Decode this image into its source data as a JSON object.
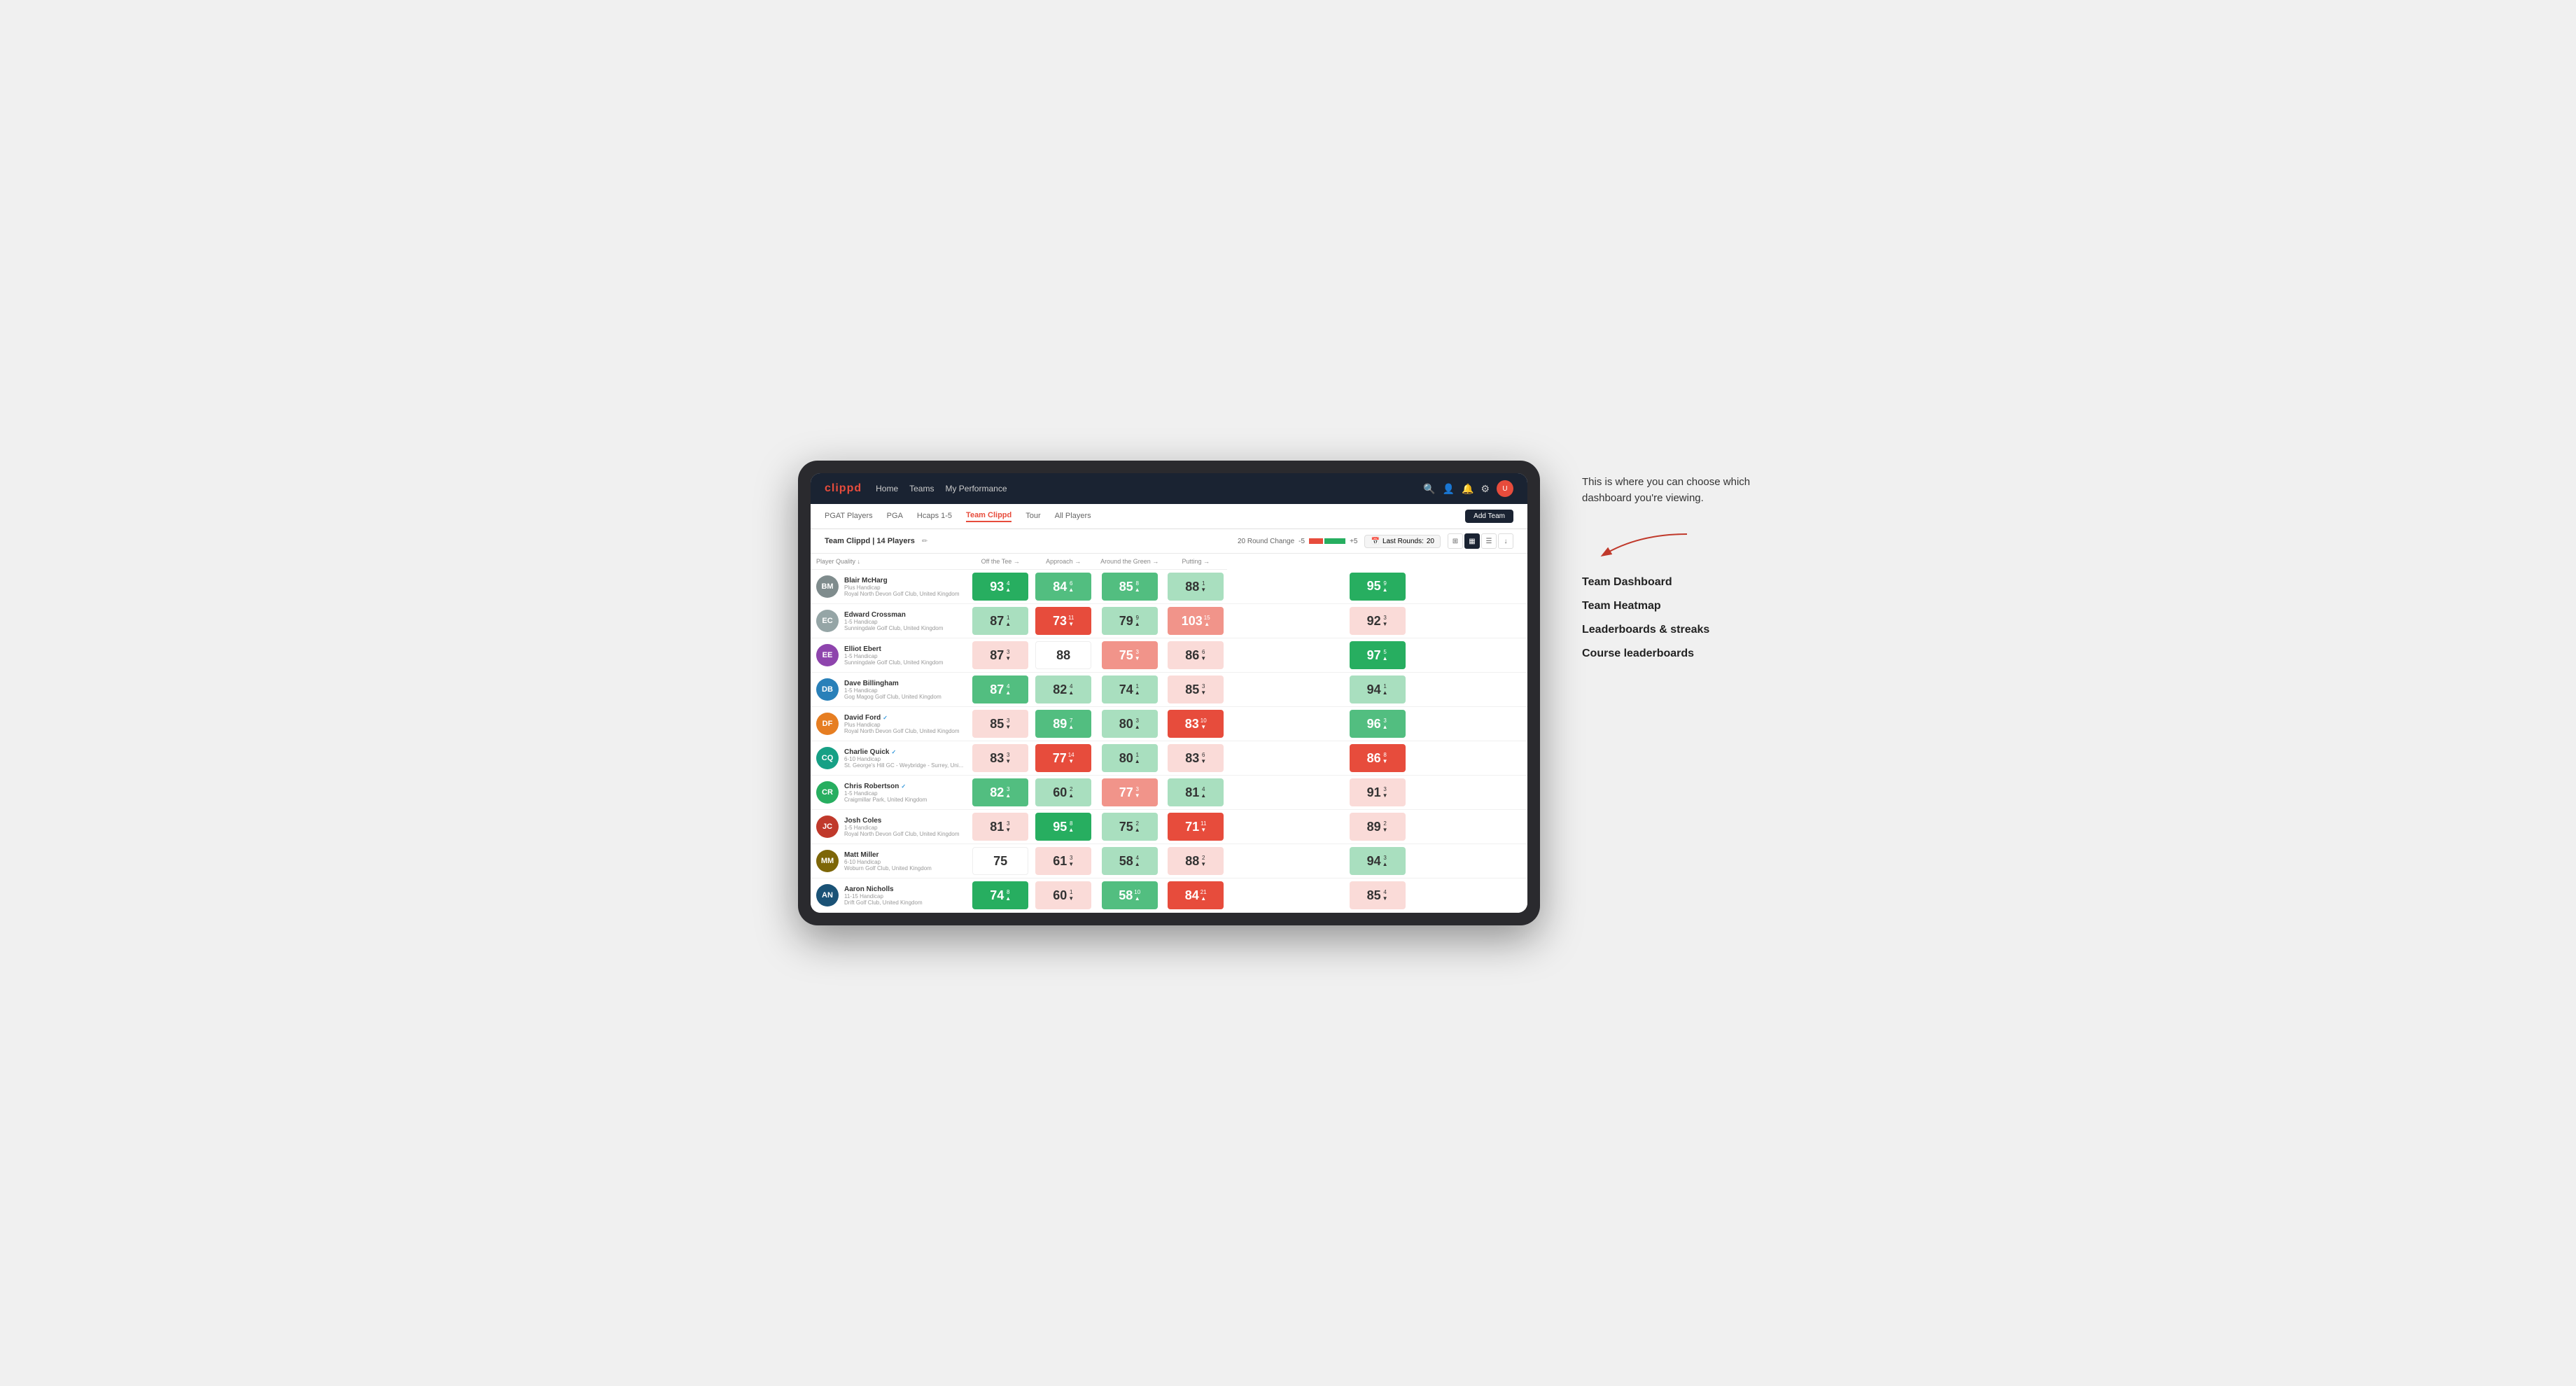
{
  "app": {
    "logo": "clippd",
    "nav": {
      "items": [
        {
          "label": "Home"
        },
        {
          "label": "Teams"
        },
        {
          "label": "My Performance"
        }
      ]
    },
    "tabs": [
      {
        "label": "PGAT Players",
        "active": false
      },
      {
        "label": "PGA",
        "active": false
      },
      {
        "label": "Hcaps 1-5",
        "active": false
      },
      {
        "label": "Team Clippd",
        "active": true
      },
      {
        "label": "Tour",
        "active": false
      },
      {
        "label": "All Players",
        "active": false
      }
    ],
    "add_team_label": "Add Team"
  },
  "team": {
    "name": "Team Clippd",
    "count_label": "14 Players",
    "round_change_label": "20 Round Change",
    "change_min": "-5",
    "change_max": "+5",
    "last_rounds_label": "Last Rounds:",
    "last_rounds_value": "20"
  },
  "table": {
    "columns": [
      {
        "label": "Player Quality ↓",
        "key": "quality"
      },
      {
        "label": "Off the Tee →",
        "key": "tee"
      },
      {
        "label": "Approach →",
        "key": "approach"
      },
      {
        "label": "Around the Green →",
        "key": "around"
      },
      {
        "label": "Putting →",
        "key": "putting"
      }
    ],
    "players": [
      {
        "name": "Blair McHarg",
        "handicap": "Plus Handicap",
        "club": "Royal North Devon Golf Club, United Kingdom",
        "initials": "BM",
        "color": "#7f8c8d",
        "quality": {
          "score": 93,
          "change": 4,
          "dir": "up",
          "color": "green-dark"
        },
        "tee": {
          "score": 84,
          "change": 6,
          "dir": "up",
          "color": "green-med"
        },
        "approach": {
          "score": 85,
          "change": 8,
          "dir": "up",
          "color": "green-med"
        },
        "around": {
          "score": 88,
          "change": 1,
          "dir": "down",
          "color": "green-light"
        },
        "putting": {
          "score": 95,
          "change": 9,
          "dir": "up",
          "color": "green-dark"
        }
      },
      {
        "name": "Edward Crossman",
        "handicap": "1-5 Handicap",
        "club": "Sunningdale Golf Club, United Kingdom",
        "initials": "EC",
        "color": "#95a5a6",
        "quality": {
          "score": 87,
          "change": 1,
          "dir": "up",
          "color": "green-light"
        },
        "tee": {
          "score": 73,
          "change": 11,
          "dir": "down",
          "color": "red-dark"
        },
        "approach": {
          "score": 79,
          "change": 9,
          "dir": "up",
          "color": "green-light"
        },
        "around": {
          "score": 103,
          "change": 15,
          "dir": "up",
          "color": "red-med"
        },
        "putting": {
          "score": 92,
          "change": 3,
          "dir": "down",
          "color": "red-light"
        }
      },
      {
        "name": "Elliot Ebert",
        "handicap": "1-5 Handicap",
        "club": "Sunningdale Golf Club, United Kingdom",
        "initials": "EE",
        "color": "#8e44ad",
        "quality": {
          "score": 87,
          "change": 3,
          "dir": "down",
          "color": "red-light"
        },
        "tee": {
          "score": 88,
          "change": null,
          "dir": null,
          "color": "neutral"
        },
        "approach": {
          "score": 75,
          "change": 3,
          "dir": "down",
          "color": "red-med"
        },
        "around": {
          "score": 86,
          "change": 6,
          "dir": "down",
          "color": "red-light"
        },
        "putting": {
          "score": 97,
          "change": 5,
          "dir": "up",
          "color": "green-dark"
        }
      },
      {
        "name": "Dave Billingham",
        "handicap": "1-5 Handicap",
        "club": "Gog Magog Golf Club, United Kingdom",
        "initials": "DB",
        "color": "#2980b9",
        "quality": {
          "score": 87,
          "change": 4,
          "dir": "up",
          "color": "green-med"
        },
        "tee": {
          "score": 82,
          "change": 4,
          "dir": "up",
          "color": "green-light"
        },
        "approach": {
          "score": 74,
          "change": 1,
          "dir": "up",
          "color": "green-light"
        },
        "around": {
          "score": 85,
          "change": 3,
          "dir": "down",
          "color": "red-light"
        },
        "putting": {
          "score": 94,
          "change": 1,
          "dir": "up",
          "color": "green-light"
        }
      },
      {
        "name": "David Ford",
        "handicap": "Plus Handicap",
        "club": "Royal North Devon Golf Club, United Kingdom",
        "initials": "DF",
        "color": "#e67e22",
        "verified": true,
        "quality": {
          "score": 85,
          "change": 3,
          "dir": "down",
          "color": "red-light"
        },
        "tee": {
          "score": 89,
          "change": 7,
          "dir": "up",
          "color": "green-med"
        },
        "approach": {
          "score": 80,
          "change": 3,
          "dir": "up",
          "color": "green-light"
        },
        "around": {
          "score": 83,
          "change": 10,
          "dir": "down",
          "color": "red-dark"
        },
        "putting": {
          "score": 96,
          "change": 3,
          "dir": "up",
          "color": "green-med"
        }
      },
      {
        "name": "Charlie Quick",
        "handicap": "6-10 Handicap",
        "club": "St. George's Hill GC - Weybridge - Surrey, Uni...",
        "initials": "CQ",
        "color": "#16a085",
        "verified": true,
        "quality": {
          "score": 83,
          "change": 3,
          "dir": "down",
          "color": "red-light"
        },
        "tee": {
          "score": 77,
          "change": 14,
          "dir": "down",
          "color": "red-dark"
        },
        "approach": {
          "score": 80,
          "change": 1,
          "dir": "up",
          "color": "green-light"
        },
        "around": {
          "score": 83,
          "change": 6,
          "dir": "down",
          "color": "red-light"
        },
        "putting": {
          "score": 86,
          "change": 8,
          "dir": "down",
          "color": "red-dark"
        }
      },
      {
        "name": "Chris Robertson",
        "handicap": "1-5 Handicap",
        "club": "Craigmillar Park, United Kingdom",
        "initials": "CR",
        "color": "#27ae60",
        "verified": true,
        "quality": {
          "score": 82,
          "change": 3,
          "dir": "up",
          "color": "green-med"
        },
        "tee": {
          "score": 60,
          "change": 2,
          "dir": "up",
          "color": "green-light"
        },
        "approach": {
          "score": 77,
          "change": 3,
          "dir": "down",
          "color": "red-med"
        },
        "around": {
          "score": 81,
          "change": 4,
          "dir": "up",
          "color": "green-light"
        },
        "putting": {
          "score": 91,
          "change": 3,
          "dir": "down",
          "color": "red-light"
        }
      },
      {
        "name": "Josh Coles",
        "handicap": "1-5 Handicap",
        "club": "Royal North Devon Golf Club, United Kingdom",
        "initials": "JC",
        "color": "#c0392b",
        "quality": {
          "score": 81,
          "change": 3,
          "dir": "down",
          "color": "red-light"
        },
        "tee": {
          "score": 95,
          "change": 8,
          "dir": "up",
          "color": "green-dark"
        },
        "approach": {
          "score": 75,
          "change": 2,
          "dir": "up",
          "color": "green-light"
        },
        "around": {
          "score": 71,
          "change": 11,
          "dir": "down",
          "color": "red-dark"
        },
        "putting": {
          "score": 89,
          "change": 2,
          "dir": "down",
          "color": "red-light"
        }
      },
      {
        "name": "Matt Miller",
        "handicap": "6-10 Handicap",
        "club": "Woburn Golf Club, United Kingdom",
        "initials": "MM",
        "color": "#7d6608",
        "quality": {
          "score": 75,
          "change": null,
          "dir": null,
          "color": "neutral"
        },
        "tee": {
          "score": 61,
          "change": 3,
          "dir": "down",
          "color": "red-light"
        },
        "approach": {
          "score": 58,
          "change": 4,
          "dir": "up",
          "color": "green-light"
        },
        "around": {
          "score": 88,
          "change": 2,
          "dir": "down",
          "color": "red-light"
        },
        "putting": {
          "score": 94,
          "change": 3,
          "dir": "up",
          "color": "green-light"
        }
      },
      {
        "name": "Aaron Nicholls",
        "handicap": "11-15 Handicap",
        "club": "Drift Golf Club, United Kingdom",
        "initials": "AN",
        "color": "#1a5276",
        "quality": {
          "score": 74,
          "change": 8,
          "dir": "up",
          "color": "green-dark"
        },
        "tee": {
          "score": 60,
          "change": 1,
          "dir": "down",
          "color": "red-light"
        },
        "approach": {
          "score": 58,
          "change": 10,
          "dir": "up",
          "color": "green-med"
        },
        "around": {
          "score": 84,
          "change": 21,
          "dir": "up",
          "color": "red-dark"
        },
        "putting": {
          "score": 85,
          "change": 4,
          "dir": "down",
          "color": "red-light"
        }
      }
    ]
  },
  "annotation": {
    "intro_text": "This is where you can choose which dashboard you're viewing.",
    "items": [
      {
        "label": "Team Dashboard"
      },
      {
        "label": "Team Heatmap"
      },
      {
        "label": "Leaderboards & streaks"
      },
      {
        "label": "Course leaderboards"
      }
    ]
  }
}
